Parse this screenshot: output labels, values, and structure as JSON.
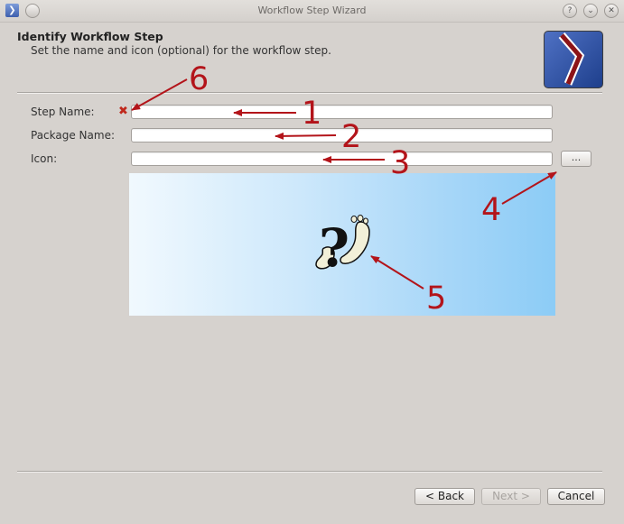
{
  "window": {
    "title": "Workflow Step Wizard",
    "app_icon": "chevron-right-icon",
    "controls": [
      "help-icon",
      "minimize-icon",
      "close-icon"
    ]
  },
  "header": {
    "title": "Identify Workflow Step",
    "subtitle": "Set the name and icon (optional) for the workflow step."
  },
  "form": {
    "step_name_label": "Step Name:",
    "step_name_value": "",
    "package_name_label": "Package Name:",
    "package_name_value": "",
    "icon_label": "Icon:",
    "icon_value": "",
    "browse_label": "...",
    "error_icon": "error-x-icon",
    "preview_icon": "question-footprints-icon"
  },
  "annotations": [
    "1",
    "2",
    "3",
    "4",
    "5",
    "6"
  ],
  "buttons": {
    "back": "< Back",
    "next": "Next >",
    "cancel": "Cancel"
  },
  "colors": {
    "annotation": "#b3141a",
    "error": "#c0291c"
  }
}
